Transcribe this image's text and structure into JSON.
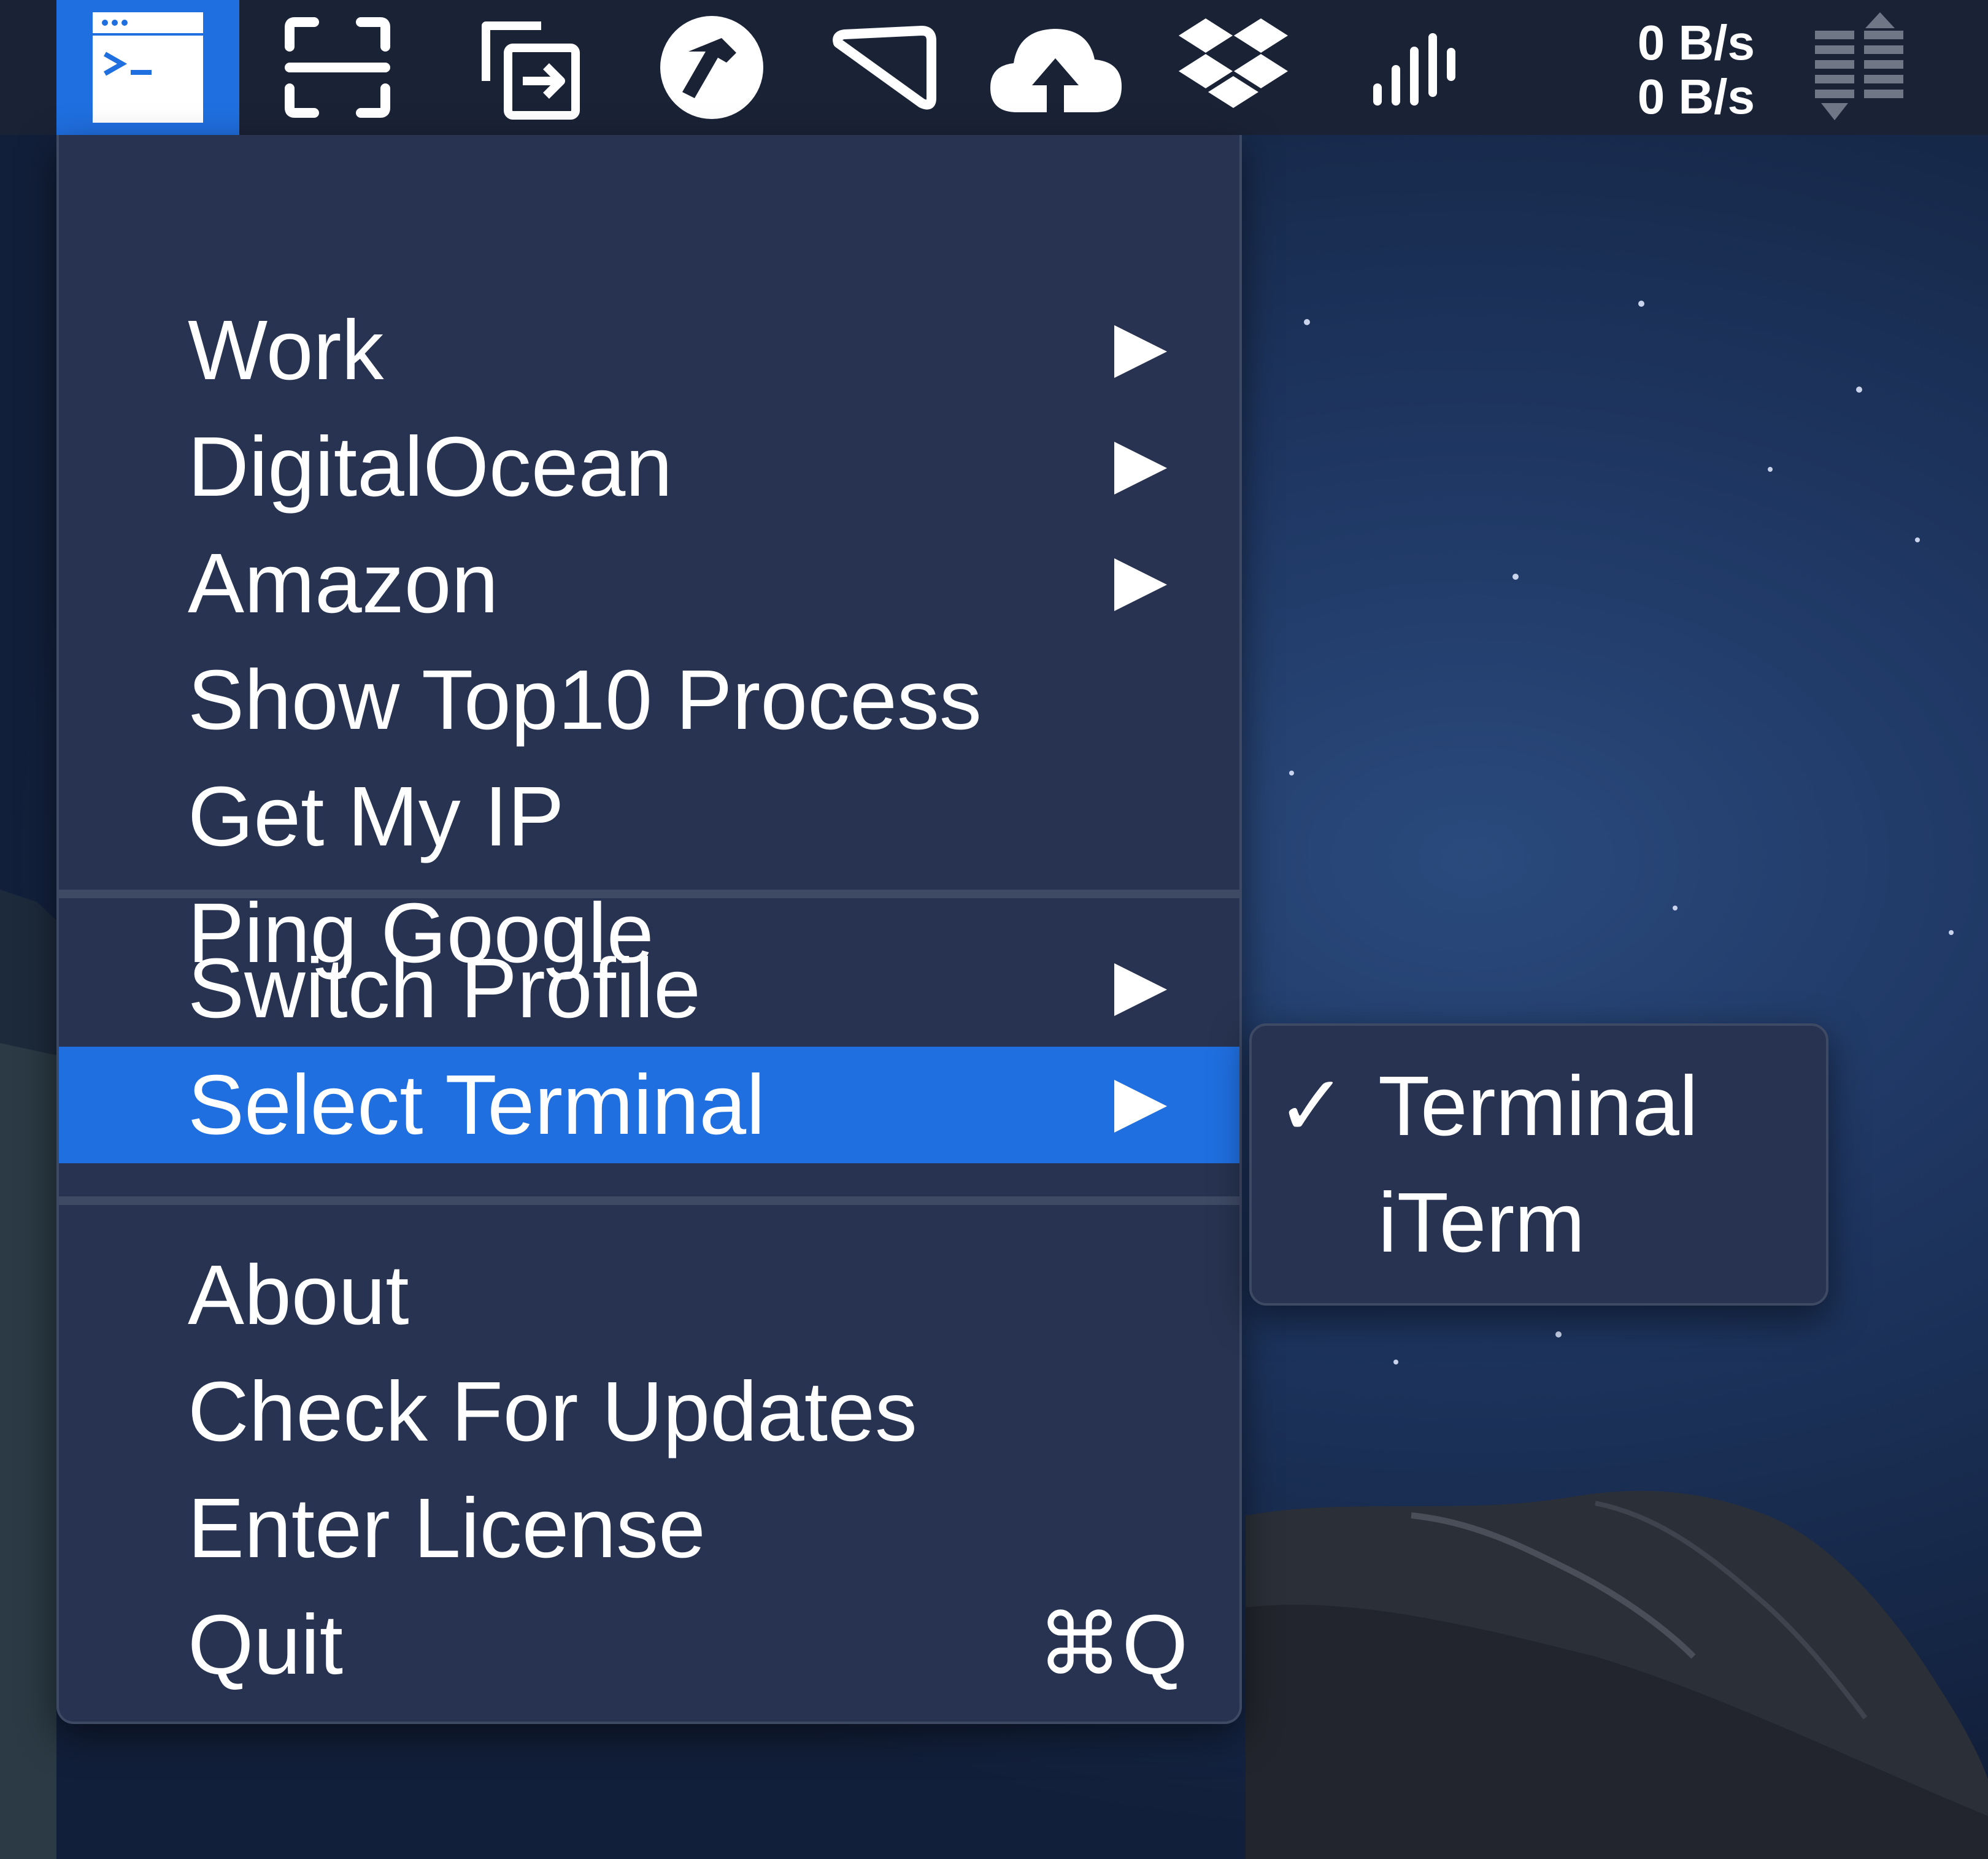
{
  "menubar": {
    "icons": [
      {
        "name": "terminal-app-icon",
        "active": true
      },
      {
        "name": "screenshot-icon",
        "active": false
      },
      {
        "name": "window-move-icon",
        "active": false
      },
      {
        "name": "hammer-icon",
        "active": false
      },
      {
        "name": "pennant-icon",
        "active": false
      },
      {
        "name": "cloud-upload-icon",
        "active": false
      },
      {
        "name": "dropbox-icon",
        "active": false
      },
      {
        "name": "signal-bars-icon",
        "active": false
      }
    ],
    "net_speed": {
      "upload": "0 B/s",
      "download": "0 B/s"
    },
    "network-graph-icon": "network-graph-icon"
  },
  "menu": {
    "groups": [
      {
        "items": [
          {
            "label": "Work",
            "submenu": true
          },
          {
            "label": "DigitalOcean",
            "submenu": true
          },
          {
            "label": "Amazon",
            "submenu": true
          },
          {
            "label": "Show Top10 Process",
            "submenu": false
          },
          {
            "label": "Get My IP",
            "submenu": false
          },
          {
            "label": "Ping Google",
            "submenu": false
          }
        ]
      },
      {
        "items": [
          {
            "label": "Switch Profile",
            "submenu": true
          },
          {
            "label": "Select Terminal",
            "submenu": true,
            "highlighted": true
          }
        ]
      },
      {
        "items": [
          {
            "label": "About",
            "submenu": false
          },
          {
            "label": "Check For Updates",
            "submenu": false
          },
          {
            "label": "Enter License",
            "submenu": false
          },
          {
            "label": "Quit",
            "submenu": false,
            "shortcut": "⌘Q"
          }
        ]
      }
    ]
  },
  "submenu": {
    "items": [
      {
        "label": "Terminal",
        "checked": true,
        "check_glyph": "✓"
      },
      {
        "label": "iTerm",
        "checked": false
      }
    ]
  },
  "colors": {
    "menubar_bg": "#1a2236",
    "menu_bg": "#273350",
    "highlight": "#1f6fe0",
    "text": "#ffffff"
  }
}
